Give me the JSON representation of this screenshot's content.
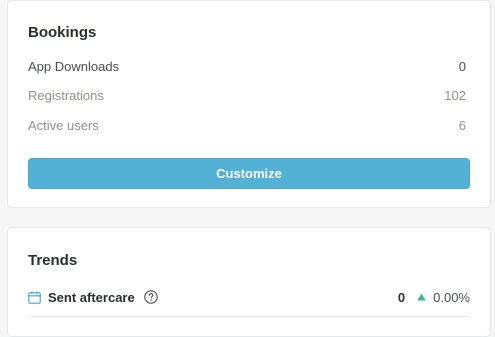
{
  "bookings": {
    "title": "Bookings",
    "stats": [
      {
        "label": "App Downloads",
        "value": "0"
      },
      {
        "label": "Registrations",
        "value": "102"
      },
      {
        "label": "Active users",
        "value": "6"
      }
    ],
    "customize_label": "Customize"
  },
  "trends": {
    "title": "Trends",
    "items": [
      {
        "icon": "calendar-icon",
        "label": "Sent aftercare",
        "count": "0",
        "change": "0.00%",
        "direction": "up"
      }
    ]
  },
  "colors": {
    "accent": "#52b1d4",
    "trend_up": "#3fb98a"
  }
}
